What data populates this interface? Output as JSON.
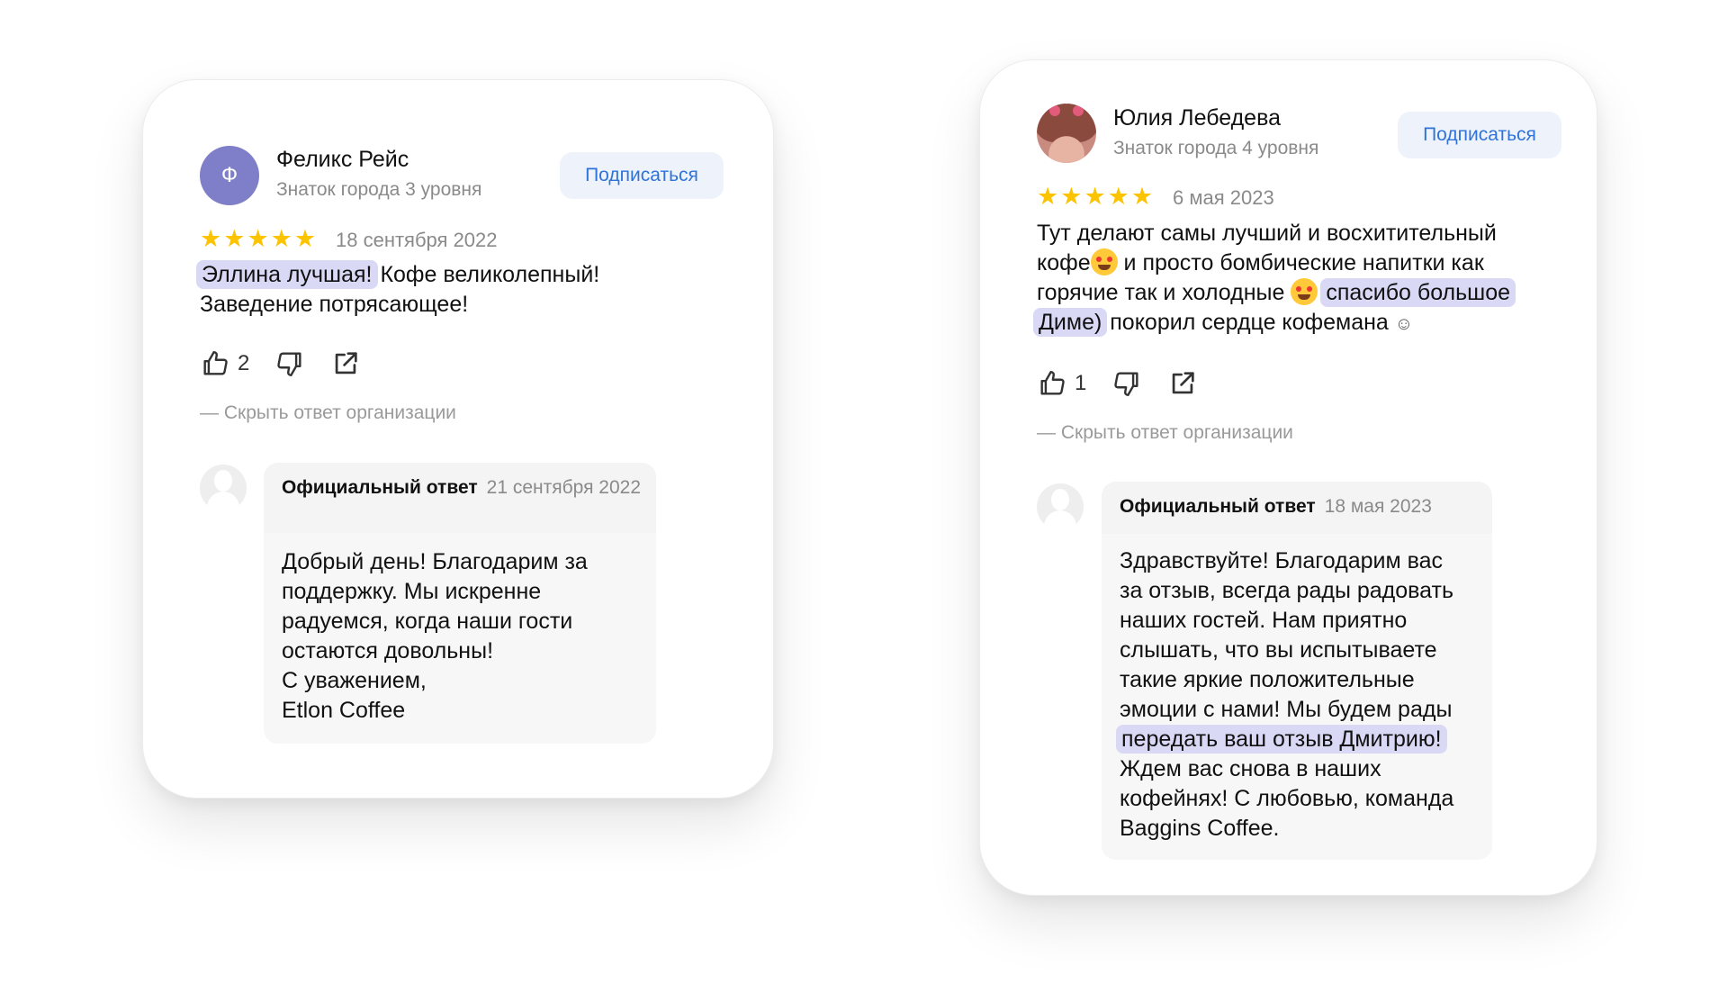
{
  "reviews": [
    {
      "avatar_letter": "Ф",
      "name": "Феликс Рейс",
      "level": "Знаток города 3 уровня",
      "subscribe_label": "Подписаться",
      "stars": 5,
      "date": "18 сентября 2022",
      "text": {
        "highlight1": "Эллина лучшая!",
        "part2": " Кофе великолепный!",
        "part3": "Заведение потрясающее!"
      },
      "likes": "2",
      "hide_answer_label": "— Скрыть ответ организации",
      "reply": {
        "title": "Официальный ответ",
        "date": "21 сентября 2022",
        "body": [
          "Добрый день! Благодарим за",
          "поддержку. Мы искренне",
          "радуемся, когда наши гости",
          "остаются довольны!",
          "С уважением,",
          "Etlon Coffee"
        ]
      }
    },
    {
      "name": "Юлия Лебедева",
      "level": "Знаток города 4 уровня",
      "subscribe_label": "Подписаться",
      "stars": 5,
      "date": "6 мая 2023",
      "text": {
        "line1": "Тут делают самы лучший и восхитительный",
        "line2a": "кофе",
        "line2b": " и просто бомбические напитки как",
        "line3a": "горячие так и холодные ",
        "line3hl": "спасибо большое",
        "line4hl": "Диме)",
        "line4b": " покорил сердце кофемана ",
        "smile": "☺"
      },
      "likes": "1",
      "hide_answer_label": "— Скрыть ответ организации",
      "reply": {
        "title": "Официальный ответ",
        "date": "18 мая 2023",
        "body": [
          "Здравствуйте! Благодарим вас",
          "за отзыв, всегда рады радовать",
          "наших гостей. Нам приятно",
          "слышать, что вы испытываете",
          "такие яркие положительные",
          "эмоции с нами! Мы будем рады"
        ],
        "highlight": "передать ваш отзыв Дмитрию!",
        "body2": [
          "Ждем вас снова в наших",
          "кофейнях! С любовью, команда",
          "Baggins Coffee."
        ]
      }
    }
  ],
  "colors": {
    "accent": "#2f73d8",
    "star": "#fcc400",
    "highlight": "#d9d9f6",
    "muted": "#8a8a8a"
  },
  "icons": [
    "thumb-up-icon",
    "thumb-down-icon",
    "share-icon",
    "star-icon"
  ]
}
